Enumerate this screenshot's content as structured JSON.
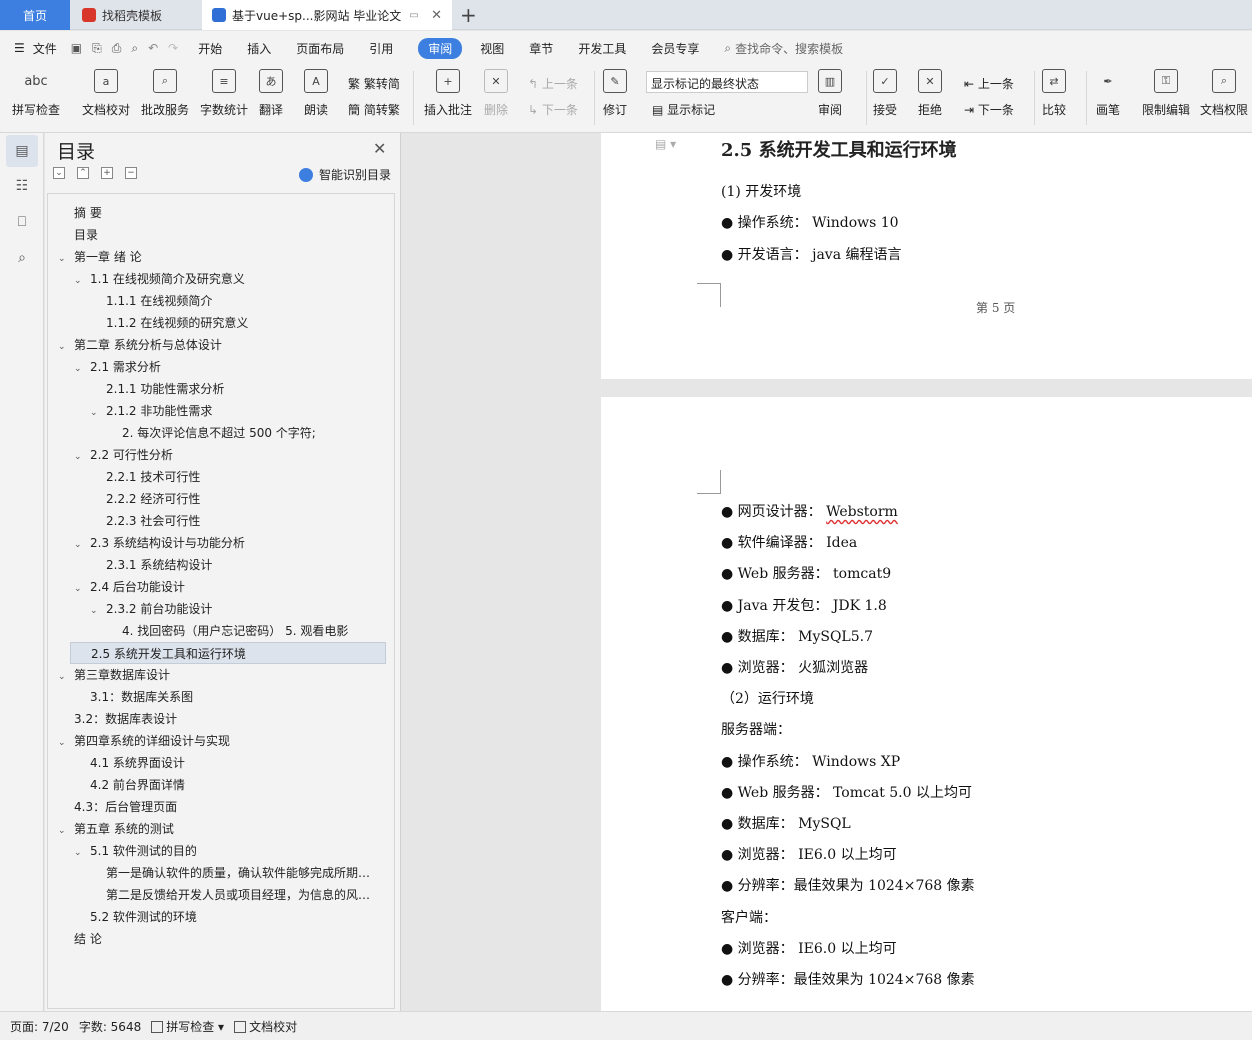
{
  "tabs": [
    {
      "label": "首页"
    },
    {
      "label": "找稻壳模板"
    },
    {
      "label": "基于vue+sp...影网站 毕业论文"
    }
  ],
  "menu": {
    "file": "文件",
    "items": [
      "开始",
      "插入",
      "页面布局",
      "引用",
      "审阅",
      "视图",
      "章节",
      "开发工具",
      "会员专享"
    ],
    "search": "查找命令、搜索模板"
  },
  "ribbon": {
    "spell": "拼写检查",
    "spell_icon": "abc",
    "proof": "文档校对",
    "review_service": "批改服务",
    "wordcount": "字数统计",
    "translate": "翻译",
    "read": "朗读",
    "trad": "繁转简",
    "simp": "简转繁",
    "add_comment": "插入批注",
    "delete": "删除",
    "prev_c": "上一条",
    "next_c": "下一条",
    "revise": "修订",
    "markup_select": "显示标记的最终状态",
    "show_markup": "显示标记",
    "review": "审阅",
    "accept": "接受",
    "reject": "拒绝",
    "prev": "上一条",
    "next": "下一条",
    "compare": "比较",
    "pen": "画笔",
    "restrict": "限制编辑",
    "doc_perm": "文档权限"
  },
  "toc": {
    "title": "目录",
    "ai_label": "智能识别目录",
    "items": [
      {
        "label": "摘  要",
        "level": 0,
        "caret": ""
      },
      {
        "label": "目录",
        "level": 0,
        "caret": ""
      },
      {
        "label": "第一章  绪  论",
        "level": 0,
        "caret": "v"
      },
      {
        "label": "1.1  在线视频简介及研究意义",
        "level": 1,
        "caret": "v"
      },
      {
        "label": "1.1.1  在线视频简介",
        "level": 2,
        "caret": ""
      },
      {
        "label": "1.1.2  在线视频的研究意义",
        "level": 2,
        "caret": ""
      },
      {
        "label": "第二章  系统分析与总体设计",
        "level": 0,
        "caret": "v"
      },
      {
        "label": "2.1  需求分析",
        "level": 1,
        "caret": "v"
      },
      {
        "label": "2.1.1  功能性需求分析",
        "level": 2,
        "caret": ""
      },
      {
        "label": "2.1.2  非功能性需求",
        "level": 2,
        "caret": "v"
      },
      {
        "label": "2.  每次评论信息不超过  500  个字符;",
        "level": 3,
        "caret": ""
      },
      {
        "label": "2.2  可行性分析",
        "level": 1,
        "caret": "v"
      },
      {
        "label": "2.2.1  技术可行性",
        "level": 2,
        "caret": ""
      },
      {
        "label": "2.2.2  经济可行性",
        "level": 2,
        "caret": ""
      },
      {
        "label": "2.2.3  社会可行性",
        "level": 2,
        "caret": ""
      },
      {
        "label": "2.3  系统结构设计与功能分析",
        "level": 1,
        "caret": "v"
      },
      {
        "label": "2.3.1  系统结构设计",
        "level": 2,
        "caret": ""
      },
      {
        "label": "2.4  后台功能设计",
        "level": 1,
        "caret": "v"
      },
      {
        "label": "2.3.2  前台功能设计",
        "level": 2,
        "caret": "v"
      },
      {
        "label": "4.  找回密码（用户忘记密码）   5.  观看电影",
        "level": 3,
        "caret": ""
      },
      {
        "label": "2.5  系统开发工具和运行环境",
        "level": 1,
        "caret": "",
        "selected": true
      },
      {
        "label": "第三章数据库设计",
        "level": 0,
        "caret": "v"
      },
      {
        "label": "3.1：数据库关系图",
        "level": 1,
        "caret": ""
      },
      {
        "label": "3.2：数据库表设计",
        "level": 0,
        "caret": ""
      },
      {
        "label": "第四章系统的详细设计与实现",
        "level": 0,
        "caret": "v"
      },
      {
        "label": "4.1  系统界面设计",
        "level": 1,
        "caret": ""
      },
      {
        "label": "4.2  前台界面详情",
        "level": 1,
        "caret": ""
      },
      {
        "label": "4.3：后台管理页面",
        "level": 0,
        "caret": ""
      },
      {
        "label": "第五章  系统的测试",
        "level": 0,
        "caret": "v"
      },
      {
        "label": "5.1  软件测试的目的",
        "level": 1,
        "caret": "v"
      },
      {
        "label": "第一是确认软件的质量，确认软件能够完成所期…",
        "level": 2,
        "caret": ""
      },
      {
        "label": "第二是反馈给开发人员或项目经理，为信息的风…",
        "level": 2,
        "caret": ""
      },
      {
        "label": "5.2  软件测试的环境",
        "level": 1,
        "caret": ""
      },
      {
        "label": "结  论",
        "level": 0,
        "caret": ""
      }
    ]
  },
  "page1": {
    "heading": "2.5  系统开发工具和运行环境",
    "lines": [
      "(1) 开发环境",
      "●  操作系统：  Windows 10",
      "●  开发语言：  java  编程语言"
    ],
    "page_label": "第  5  页"
  },
  "page2": {
    "lines": [
      {
        "pre": "●  网页设计器：  ",
        "squig": "Webstorm"
      },
      {
        "pre": "●  软件编译器：  Idea"
      },
      {
        "pre": "● Web 服务器：  tomcat9"
      },
      {
        "pre": "● Java  开发包：  JDK 1.8"
      },
      {
        "pre": "●  数据库：  MySQL5.7"
      },
      {
        "pre": "●  浏览器：  火狐浏览器"
      },
      {
        "pre": "（2）运行环境"
      },
      {
        "pre": "服务器端："
      },
      {
        "pre": "●  操作系统：  Windows XP"
      },
      {
        "pre": "● Web 服务器：  Tomcat 5.0  以上均可"
      },
      {
        "pre": "●  数据库：  MySQL"
      },
      {
        "pre": "●  浏览器：  IE6.0  以上均可"
      },
      {
        "pre": "●  分辨率：最佳效果为  1024×768  像素"
      },
      {
        "pre": "客户端："
      },
      {
        "pre": "●  浏览器：  IE6.0  以上均可"
      },
      {
        "pre": "●  分辨率：最佳效果为  1024×768  像素"
      }
    ]
  },
  "status": {
    "page": "页面: 7/20",
    "words": "字数: 5648",
    "spell": "拼写检查",
    "proof": "文档校对"
  },
  "colors": {
    "accent": "#3d7fe0",
    "squiggle": "#d33"
  }
}
